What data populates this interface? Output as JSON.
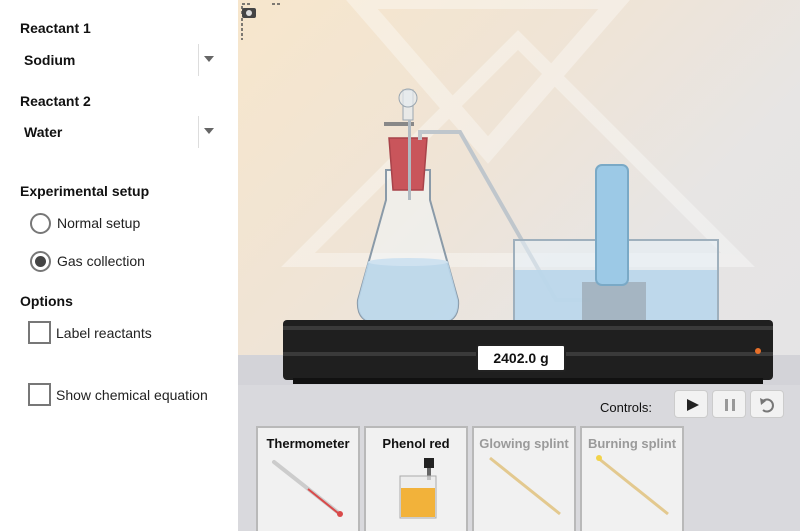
{
  "reactant1": {
    "heading": "Reactant 1",
    "selected": "Sodium"
  },
  "reactant2": {
    "heading": "Reactant 2",
    "selected": "Water"
  },
  "setup": {
    "heading": "Experimental setup",
    "options": [
      {
        "label": "Normal setup",
        "checked": false
      },
      {
        "label": "Gas collection",
        "checked": true
      }
    ]
  },
  "options": {
    "heading": "Options",
    "items": [
      {
        "label": "Label reactants",
        "checked": false
      },
      {
        "label": "Show chemical equation",
        "checked": false
      }
    ]
  },
  "stage": {
    "balance_reading": "2402.0 g",
    "controls_label": "Controls:",
    "icons": [
      "camera-icon",
      "play-icon",
      "pause-icon",
      "reset-icon"
    ]
  },
  "tools": [
    {
      "label": "Thermometer",
      "enabled": true
    },
    {
      "label": "Phenol red",
      "enabled": true
    },
    {
      "label": "Glowing splint",
      "enabled": false
    },
    {
      "label": "Burning splint",
      "enabled": false
    }
  ],
  "colors": {
    "liquid": "#b9d6ea",
    "stopper": "#c9555b",
    "indicator": "#f2b23a",
    "balance": "#1f1f1f"
  }
}
